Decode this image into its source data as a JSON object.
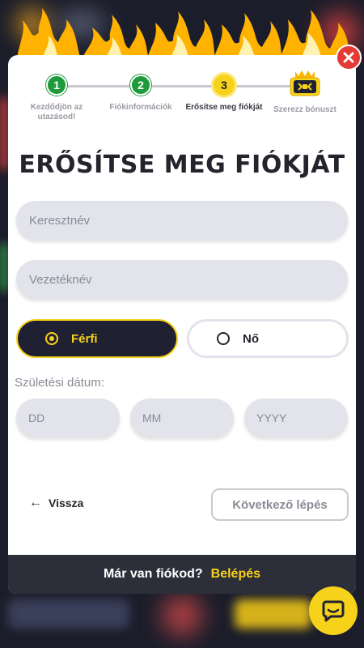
{
  "stepper": {
    "steps": [
      {
        "number": "1",
        "label": "Kezdődjön az utazásod!",
        "state": "done"
      },
      {
        "number": "2",
        "label": "Fiókinformációk",
        "state": "done"
      },
      {
        "number": "3",
        "label": "Erősítse meg fiókját",
        "state": "active"
      },
      {
        "number": "",
        "label": "Szerezz bónuszt",
        "state": "pending"
      }
    ]
  },
  "title": "ERŐSÍTSE MEG FIÓKJÁT",
  "form": {
    "first_name_placeholder": "Keresztnév",
    "last_name_placeholder": "Vezetéknév",
    "gender": {
      "male_label": "Férfi",
      "female_label": "Nő",
      "selected": "male"
    },
    "dob_label": "Születési dátum:",
    "dob_day_placeholder": "DD",
    "dob_month_placeholder": "MM",
    "dob_year_placeholder": "YYYY"
  },
  "actions": {
    "back_label": "Vissza",
    "next_label": "Következő lépés"
  },
  "footer": {
    "text": "Már van fiókod?",
    "login_label": "Belépés"
  },
  "icons": {
    "close": "close-icon",
    "chat": "chat-icon",
    "chest": "treasure-chest-icon",
    "back": "arrow-left-icon"
  },
  "colors": {
    "accent": "#f7d21a",
    "success": "#1e9a3a",
    "danger": "#e53935",
    "dark": "#1f2133"
  }
}
